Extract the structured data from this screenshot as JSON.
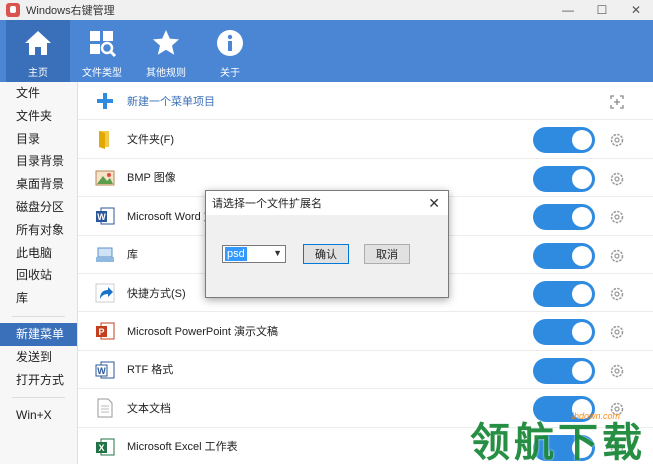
{
  "window": {
    "title": "Windows右键管理",
    "controls": {
      "minimize": "—",
      "maximize": "☐",
      "close": "✕"
    }
  },
  "toolbar": {
    "items": [
      {
        "label": "主页",
        "icon": "home-icon",
        "active": true
      },
      {
        "label": "文件类型",
        "icon": "file-types-icon",
        "active": false
      },
      {
        "label": "其他规则",
        "icon": "star-icon",
        "active": false
      },
      {
        "label": "关于",
        "icon": "info-icon",
        "active": false
      }
    ]
  },
  "sidebar": {
    "group1": [
      "文件",
      "文件夹",
      "目录",
      "目录背景",
      "桌面背景",
      "磁盘分区",
      "所有对象",
      "此电脑",
      "回收站",
      "库"
    ],
    "group2": [
      "新建菜单",
      "发送到",
      "打开方式"
    ],
    "group3": [
      "Win+X"
    ],
    "selected": "新建菜单"
  },
  "list": {
    "new_item_label": "新建一个菜单项目",
    "items": [
      {
        "label": "文件夹(F)",
        "icon": "folder-icon",
        "enabled": true
      },
      {
        "label": "BMP 图像",
        "icon": "bmp-image-icon",
        "enabled": true
      },
      {
        "label": "Microsoft Word 文",
        "icon": "word-icon",
        "enabled": true
      },
      {
        "label": "库",
        "icon": "library-icon",
        "enabled": true
      },
      {
        "label": "快捷方式(S)",
        "icon": "shortcut-icon",
        "enabled": true
      },
      {
        "label": "Microsoft PowerPoint 演示文稿",
        "icon": "powerpoint-icon",
        "enabled": true
      },
      {
        "label": "RTF 格式",
        "icon": "rtf-icon",
        "enabled": true
      },
      {
        "label": "文本文档",
        "icon": "text-doc-icon",
        "enabled": true
      },
      {
        "label": "Microsoft Excel 工作表",
        "icon": "excel-icon",
        "enabled": true
      }
    ]
  },
  "dialog": {
    "title": "请选择一个文件扩展名",
    "close": "✕",
    "select_value": "psd",
    "ok_label": "确认",
    "cancel_label": "取消"
  },
  "watermark": {
    "text": "领航下载",
    "url": "lhdown.com"
  },
  "colors": {
    "accent": "#4a86d4",
    "toggle_on": "#2f8be0",
    "selected": "#3a6fb9"
  }
}
